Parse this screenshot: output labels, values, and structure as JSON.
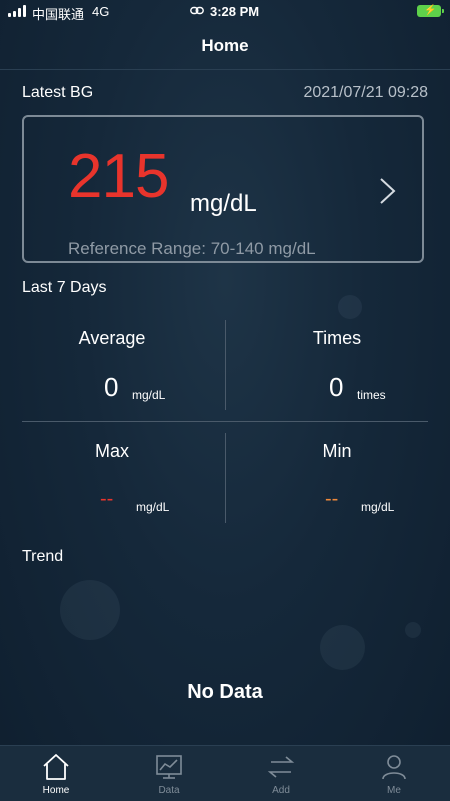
{
  "status_bar": {
    "carrier": "中国联通",
    "network": "4G",
    "time": "3:28 PM"
  },
  "header": {
    "title": "Home"
  },
  "latest": {
    "label": "Latest BG",
    "datetime": "2021/07/21 09:28",
    "value": "215",
    "unit": "mg/dL",
    "reference": "Reference Range: 70-140 mg/dL",
    "value_color": "#e8342c"
  },
  "last7": {
    "label": "Last 7 Days",
    "average": {
      "title": "Average",
      "value": "0",
      "unit": "mg/dL"
    },
    "times": {
      "title": "Times",
      "value": "0",
      "unit": "times"
    },
    "max": {
      "title": "Max",
      "value": "--",
      "unit": "mg/dL",
      "color": "#e8342c"
    },
    "min": {
      "title": "Min",
      "value": "--",
      "unit": "mg/dL",
      "color": "#f0893a"
    }
  },
  "trend": {
    "label": "Trend",
    "empty_text": "No Data"
  },
  "tabs": [
    {
      "label": "Home",
      "icon": "home-icon",
      "active": true
    },
    {
      "label": "Data",
      "icon": "chart-icon",
      "active": false
    },
    {
      "label": "Add",
      "icon": "swap-icon",
      "active": false
    },
    {
      "label": "Me",
      "icon": "user-icon",
      "active": false
    }
  ]
}
